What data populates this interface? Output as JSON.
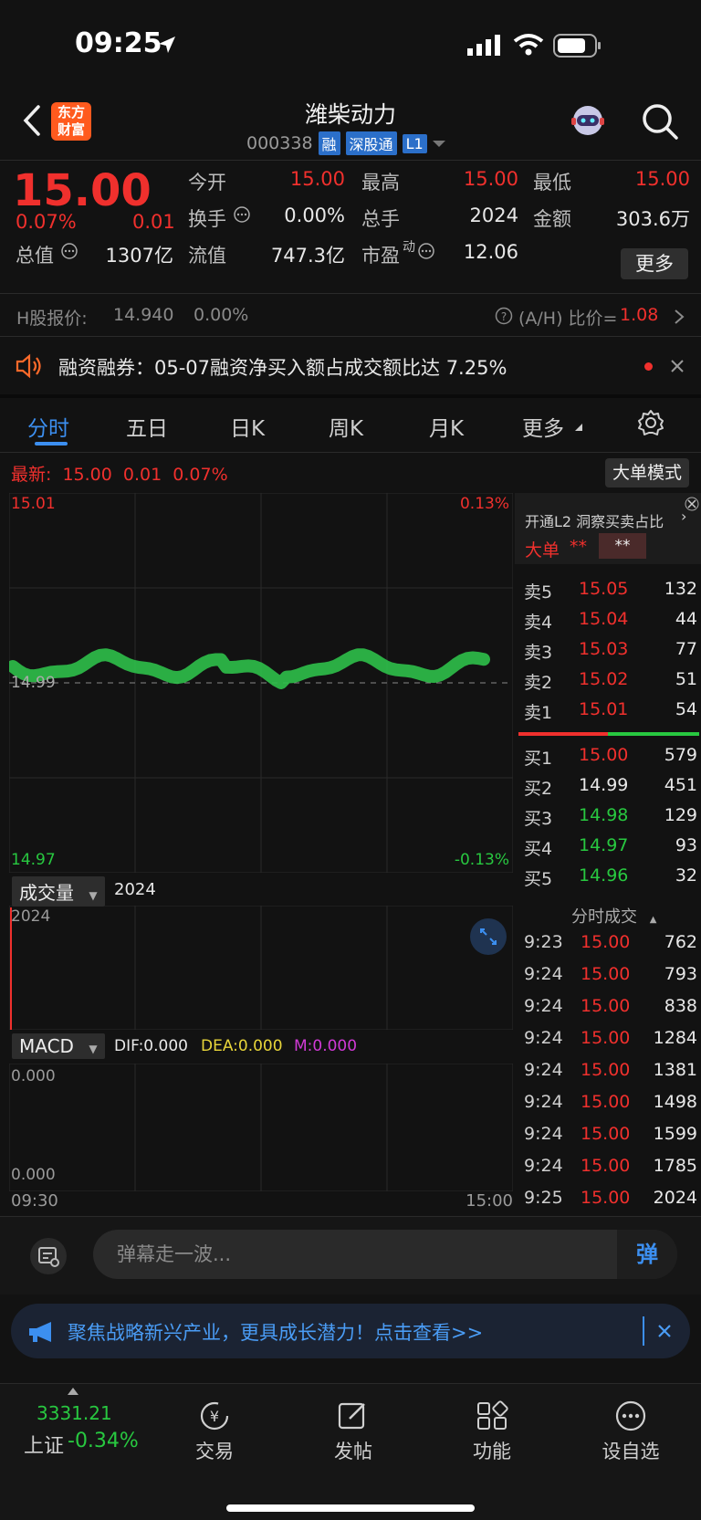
{
  "status": {
    "time": "09:25"
  },
  "header": {
    "back_icon": "chevron-left-icon",
    "logo_text_line1": "东方",
    "logo_text_line2": "财富",
    "title": "潍柴动力",
    "code": "000338",
    "tags": [
      "融",
      "深股通",
      "L1"
    ],
    "search_icon": "search-icon",
    "robot_icon": "robot-assistant-icon"
  },
  "quote": {
    "price": "15.00",
    "change_pct": "0.07%",
    "change": "0.01",
    "open_label": "今开",
    "open": "15.00",
    "high_label": "最高",
    "high": "15.00",
    "low_label": "最低",
    "low": "15.00",
    "turnover_label": "换手",
    "turnover": "0.00%",
    "volume_label": "总手",
    "volume": "2024",
    "amount_label": "金额",
    "amount": "303.6万",
    "mktcap_label": "总值",
    "mktcap": "1307亿",
    "float_label": "流值",
    "float": "747.3亿",
    "pe_label": "市盈",
    "pe_sup": "动",
    "pe": "12.06",
    "more_label": "更多"
  },
  "hshare": {
    "label": "H股报价:",
    "price": "14.940",
    "pct": "0.00%",
    "ah_label": "(A/H) 比价=",
    "ah_value": "1.08"
  },
  "news": {
    "text": "融资融券：05-07融资净买入额占成交额比达 7.25%"
  },
  "tabs": [
    "分时",
    "五日",
    "日K",
    "周K",
    "月K",
    "更多"
  ],
  "chart": {
    "latest_label": "最新:",
    "latest_price": "15.00",
    "latest_change": "0.01",
    "latest_pct": "0.07%",
    "bigorder_label": "大单模式",
    "y_top": "15.01",
    "y_mid": "14.99",
    "y_bottom": "14.97",
    "pct_top": "0.13%",
    "pct_bottom": "-0.13%",
    "volume_label": "成交量",
    "volume_value": "2024",
    "volume_axis": "2024",
    "macd_label": "MACD",
    "dif": "DIF:0.000",
    "dea": "DEA:0.000",
    "m": "M:0.000",
    "macd_top": "0.000",
    "macd_bottom": "0.000",
    "time_start": "09:30",
    "time_end": "15:00"
  },
  "orderbook": {
    "l2_text": "开通L2 洞察买卖占比",
    "bigorder_label": "大单",
    "bigorder_val1": "**",
    "bigorder_val2": "**",
    "asks": [
      {
        "label": "卖5",
        "price": "15.05",
        "vol": "132"
      },
      {
        "label": "卖4",
        "price": "15.04",
        "vol": "44"
      },
      {
        "label": "卖3",
        "price": "15.03",
        "vol": "77"
      },
      {
        "label": "卖2",
        "price": "15.02",
        "vol": "51"
      },
      {
        "label": "卖1",
        "price": "15.01",
        "vol": "54"
      }
    ],
    "bids": [
      {
        "label": "买1",
        "price": "15.00",
        "vol": "579"
      },
      {
        "label": "买2",
        "price": "14.99",
        "vol": "451"
      },
      {
        "label": "买3",
        "price": "14.98",
        "vol": "129"
      },
      {
        "label": "买4",
        "price": "14.97",
        "vol": "93"
      },
      {
        "label": "买5",
        "price": "14.96",
        "vol": "32"
      }
    ],
    "ticks_title": "分时成交",
    "ticks": [
      {
        "t": "9:23",
        "p": "15.00",
        "v": "762"
      },
      {
        "t": "9:24",
        "p": "15.00",
        "v": "793"
      },
      {
        "t": "9:24",
        "p": "15.00",
        "v": "838"
      },
      {
        "t": "9:24",
        "p": "15.00",
        "v": "1284"
      },
      {
        "t": "9:24",
        "p": "15.00",
        "v": "1381"
      },
      {
        "t": "9:24",
        "p": "15.00",
        "v": "1498"
      },
      {
        "t": "9:24",
        "p": "15.00",
        "v": "1599"
      },
      {
        "t": "9:24",
        "p": "15.00",
        "v": "1785"
      },
      {
        "t": "9:25",
        "p": "15.00",
        "v": "2024"
      }
    ]
  },
  "danmu": {
    "placeholder": "弹幕走一波...",
    "btn": "弹"
  },
  "banner": {
    "text": "聚焦战略新兴产业，更具成长潜力！点击查看>>"
  },
  "tabbar": {
    "index_value": "3331.21",
    "index_name": "上证",
    "index_pct": "-0.34%",
    "items": [
      "交易",
      "发帖",
      "功能",
      "设自选"
    ]
  },
  "colors": {
    "up": "#f0302d",
    "down": "#28c840",
    "accent": "#3c8ff0"
  }
}
